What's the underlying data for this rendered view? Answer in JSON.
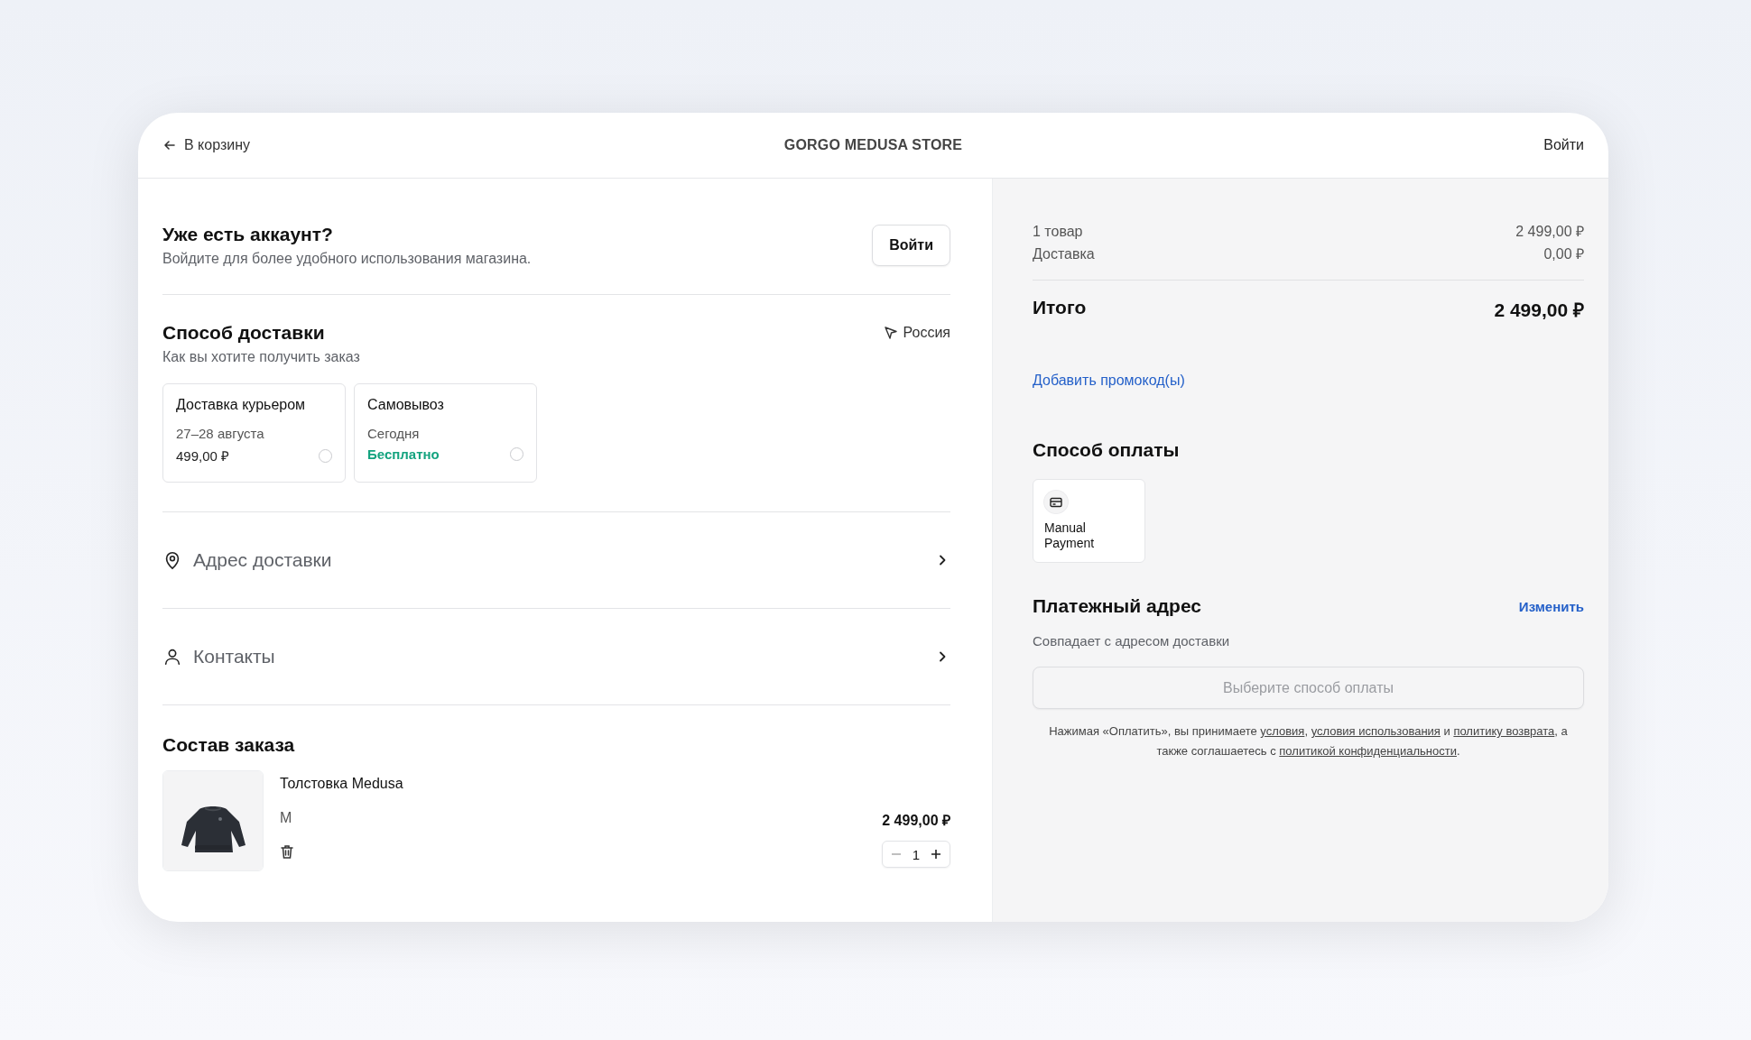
{
  "header": {
    "back_link": "В корзину",
    "store_name": "GORGO MEDUSA STORE",
    "login_link": "Войти"
  },
  "account": {
    "title": "Уже есть аккаунт?",
    "subtitle": "Войдите для более удобного использования магазина.",
    "button": "Войти"
  },
  "delivery": {
    "title": "Способ доставки",
    "subtitle": "Как вы хотите получить заказ",
    "country": "Россия",
    "options": [
      {
        "name": "Доставка курьером",
        "date": "27–28 августа",
        "price": "499,00 ₽",
        "free": false,
        "selected": false
      },
      {
        "name": "Самовывоз",
        "date": "Сегодня",
        "price": "Бесплатно",
        "free": true,
        "selected": false
      }
    ]
  },
  "sections": [
    {
      "kind": "address",
      "label": "Адрес доставки"
    },
    {
      "kind": "contacts",
      "label": "Контакты"
    }
  ],
  "order": {
    "title": "Состав заказа",
    "items": [
      {
        "name": "Толстовка Medusa",
        "variant": "M",
        "price": "2 499,00 ₽",
        "quantity": "1",
        "kind": "picture"
      }
    ]
  },
  "summary": {
    "lines": [
      {
        "label": "1 товар",
        "value": "2 499,00 ₽"
      },
      {
        "label": "Доставка",
        "value": "0,00 ₽"
      }
    ],
    "total_label": "Итого",
    "total_value": "2 499,00 ₽",
    "promo_link": "Добавить промокод(ы)"
  },
  "payment": {
    "title": "Способ оплаты",
    "methods": [
      {
        "name": "Manual Payment",
        "selected": false
      }
    ]
  },
  "billing": {
    "title": "Платежный адрес",
    "edit_link": "Изменить",
    "text": "Совпадает с адресом доставки"
  },
  "pay_button": {
    "label": "Выберите способ оплаты",
    "disabled": true
  },
  "terms": [
    {
      "kind": "text",
      "text": "Нажимая «Оплатить», вы принимаете "
    },
    {
      "kind": "link",
      "text": "условия"
    },
    {
      "kind": "text",
      "text": ", "
    },
    {
      "kind": "link",
      "text": "условия использования"
    },
    {
      "kind": "text",
      "text": " и "
    },
    {
      "kind": "link",
      "text": "политику возврата"
    },
    {
      "kind": "text",
      "text": ", а также соглашаетесь с "
    },
    {
      "kind": "link",
      "text": "политикой конфиденциальности"
    },
    {
      "kind": "text",
      "text": "."
    }
  ]
}
